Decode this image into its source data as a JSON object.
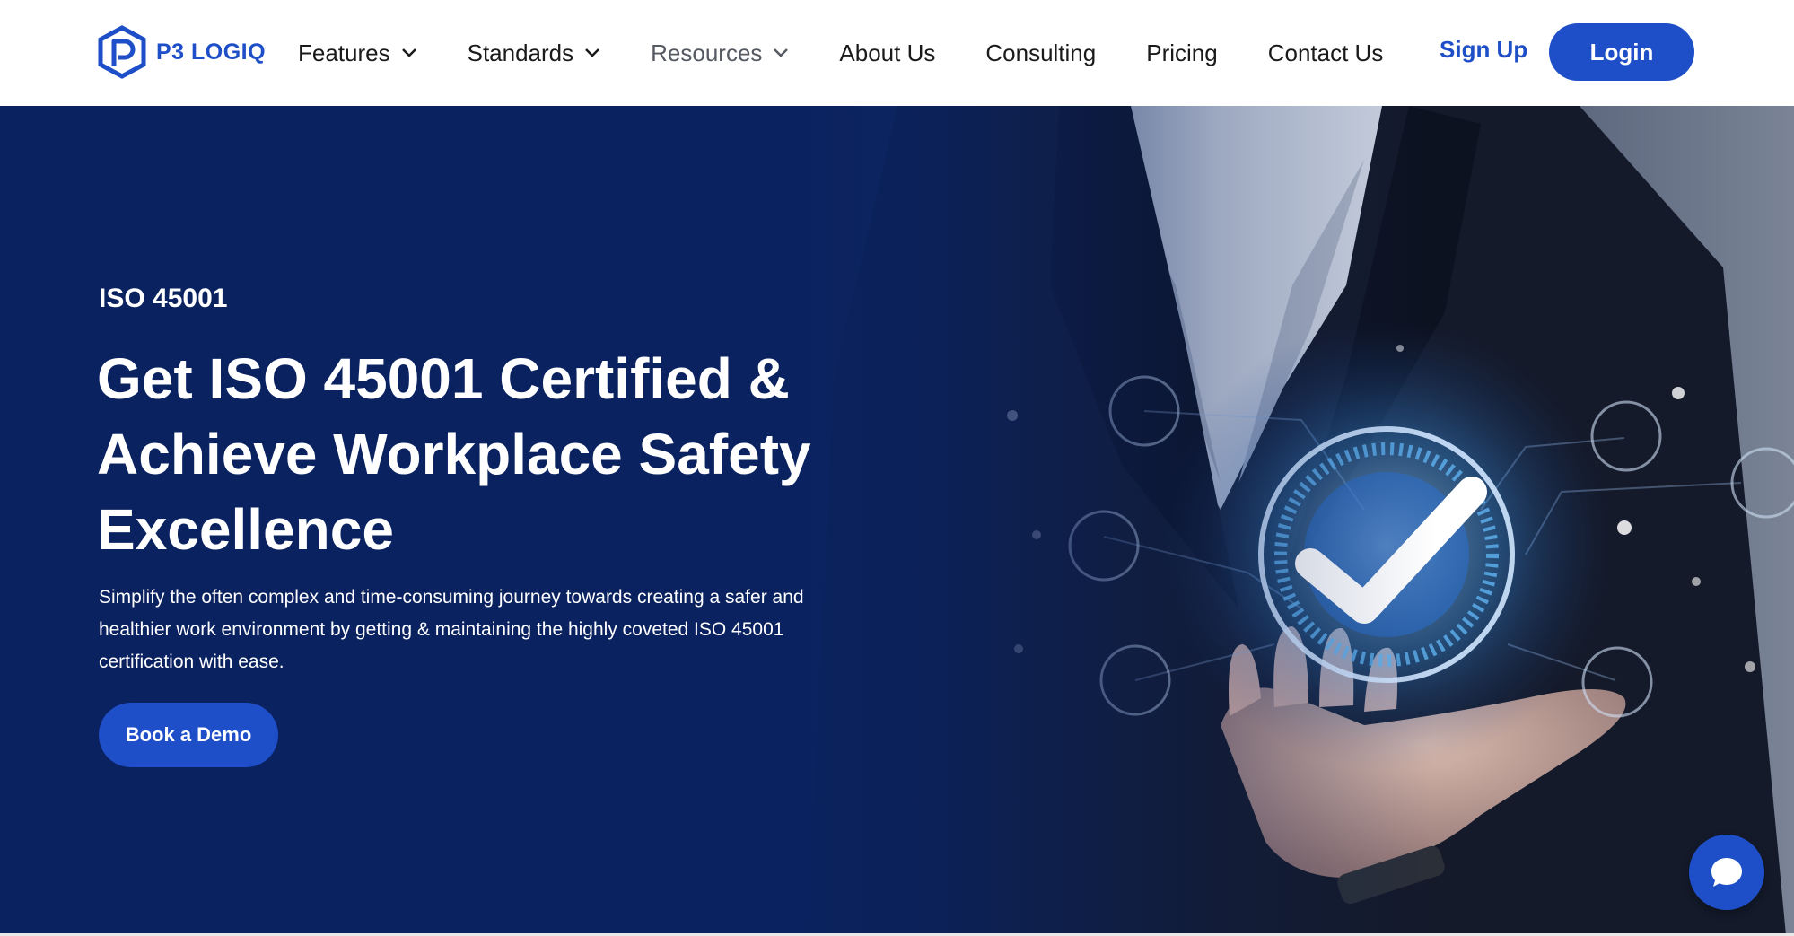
{
  "header": {
    "logo_text": "P3 LOGIQ",
    "nav": [
      {
        "label": "Features"
      },
      {
        "label": "Standards"
      },
      {
        "label": "Resources"
      },
      {
        "label": "About Us"
      },
      {
        "label": "Consulting"
      },
      {
        "label": "Pricing"
      },
      {
        "label": "Contact Us"
      }
    ],
    "signup_label": "Sign Up",
    "login_label": "Login"
  },
  "hero": {
    "eyebrow": "ISO 45001",
    "headline": "Get ISO 45001 Certified & Achieve Workplace Safety Excellence",
    "subtext": "Simplify the often complex and time-consuming journey towards creating a safer and healthier work environment by getting & maintaining the highly coveted ISO 45001 certification with ease.",
    "cta_label": "Book a Demo"
  },
  "colors": {
    "brand_blue": "#1e4fc8",
    "hero_navy": "#0a2260"
  }
}
